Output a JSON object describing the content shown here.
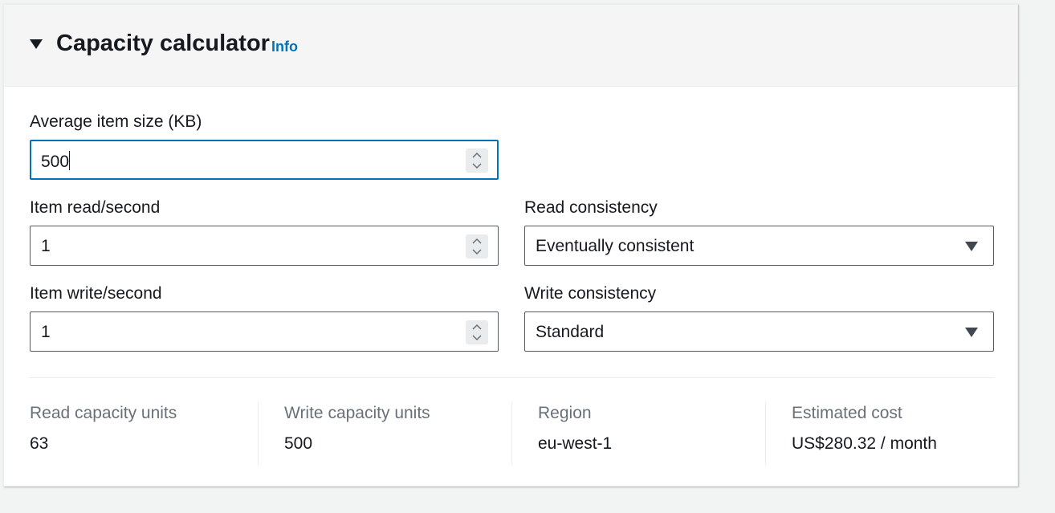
{
  "header": {
    "title": "Capacity calculator",
    "info_label": "Info"
  },
  "form": {
    "item_size": {
      "label": "Average item size (KB)",
      "value": "500"
    },
    "item_read": {
      "label": "Item read/second",
      "value": "1"
    },
    "item_write": {
      "label": "Item write/second",
      "value": "1"
    },
    "read_consistency": {
      "label": "Read consistency",
      "value": "Eventually consistent"
    },
    "write_consistency": {
      "label": "Write consistency",
      "value": "Standard"
    }
  },
  "summary": {
    "read_capacity": {
      "label": "Read capacity units",
      "value": "63"
    },
    "write_capacity": {
      "label": "Write capacity units",
      "value": "500"
    },
    "region": {
      "label": "Region",
      "value": "eu-west-1"
    },
    "estimated_cost": {
      "label": "Estimated cost",
      "value": "US$280.32 / month"
    }
  },
  "colors": {
    "accent": "#0073bb",
    "text": "#16191f",
    "muted": "#687078"
  },
  "icons": {
    "expand": "caret-down-icon",
    "spinner": "spinner-updown-icon",
    "dropdown": "caret-down-icon"
  }
}
